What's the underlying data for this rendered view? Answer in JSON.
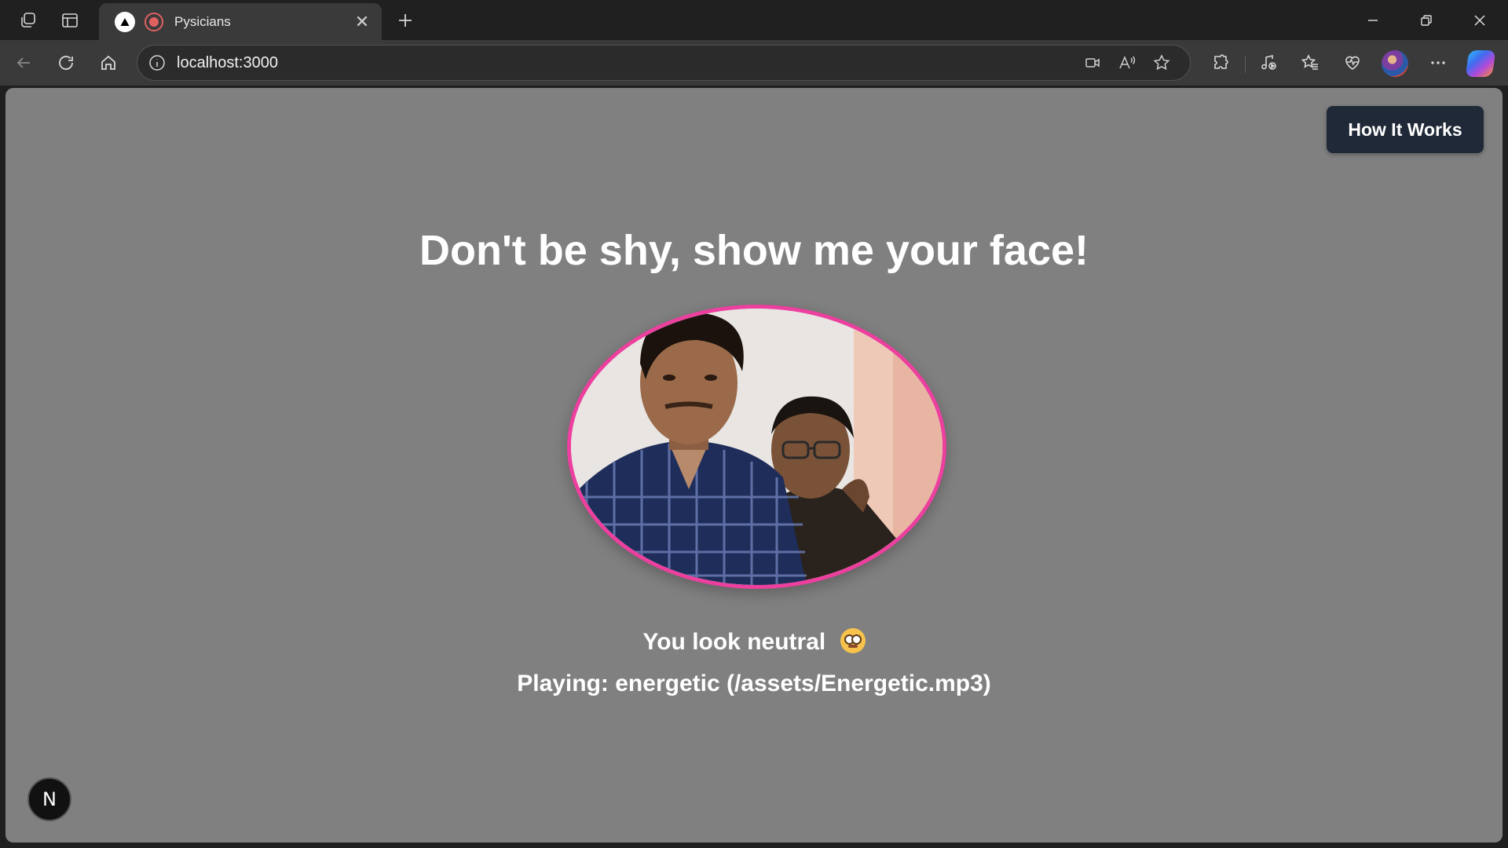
{
  "browser": {
    "tab": {
      "title": "Pysicians",
      "close": "✕"
    },
    "new_tab": "+",
    "url": "localhost:3000",
    "icons": [
      "workspaces-icon",
      "tab-actions-icon",
      "back-icon",
      "refresh-icon",
      "home-icon",
      "info-icon",
      "camera-icon",
      "read-aloud-icon",
      "favorite-icon",
      "extensions-icon",
      "media-icon",
      "favorites-icon",
      "health-icon",
      "profile-avatar",
      "more-icon",
      "copilot-icon"
    ]
  },
  "page": {
    "how_it_works_label": "How It Works",
    "headline": "Don't be shy, show me your face!",
    "mood_text": "You look neutral",
    "mood_emoji": "flushed-face-icon",
    "playing_text": "Playing: energetic (/assets/Energetic.mp3)",
    "nextjs_badge": "N"
  },
  "colors": {
    "page_bg": "#808080",
    "button_bg": "#1f2937",
    "webcam_border": "#ec3f9e"
  }
}
